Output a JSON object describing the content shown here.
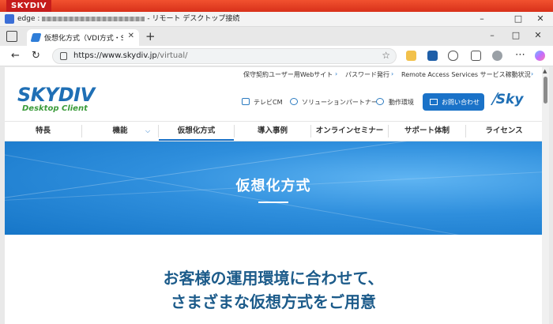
{
  "remote_bar": {
    "brand": "SKYDIV"
  },
  "outer_window": {
    "app": "edge :",
    "title_suffix": "- リモート デスクトップ接続",
    "controls": [
      "–",
      "□",
      "✕"
    ]
  },
  "browser": {
    "tab": {
      "title": "仮想化方式（VDI方式・SBC方",
      "close": "✕"
    },
    "new_tab": "+",
    "window_controls": [
      "–",
      "□",
      "✕"
    ],
    "nav": {
      "back": "←",
      "reload": "↻",
      "more": "⋯"
    },
    "url": {
      "origin": "https://www.skydiv.jp",
      "path": "/virtual/"
    },
    "star": "☆"
  },
  "page": {
    "util_links": [
      "保守契約ユーザー用Webサイト",
      "パスワード発行",
      "Remote Access Services サービス稼動状況"
    ],
    "logo": {
      "main": "SKYDIV",
      "sub": "Desktop Client"
    },
    "header_links": [
      "テレビCM",
      "ソリューションパートナー",
      "動作環境"
    ],
    "contact_button": "お問い合わせ",
    "corp_logo": "Sky",
    "gnav": [
      "特長",
      "機能",
      "仮想化方式",
      "導入事例",
      "オンラインセミナー",
      "サポート体制",
      "ライセンス"
    ],
    "hero_title": "仮想化方式",
    "lead_line1": "お客様の運用環境に合わせて、",
    "lead_line2": "さまざまな仮想方式をご用意"
  },
  "colors": {
    "accent": "#1a72c8",
    "heading": "#1c5b8a",
    "remote_bar": "#d8311a"
  }
}
